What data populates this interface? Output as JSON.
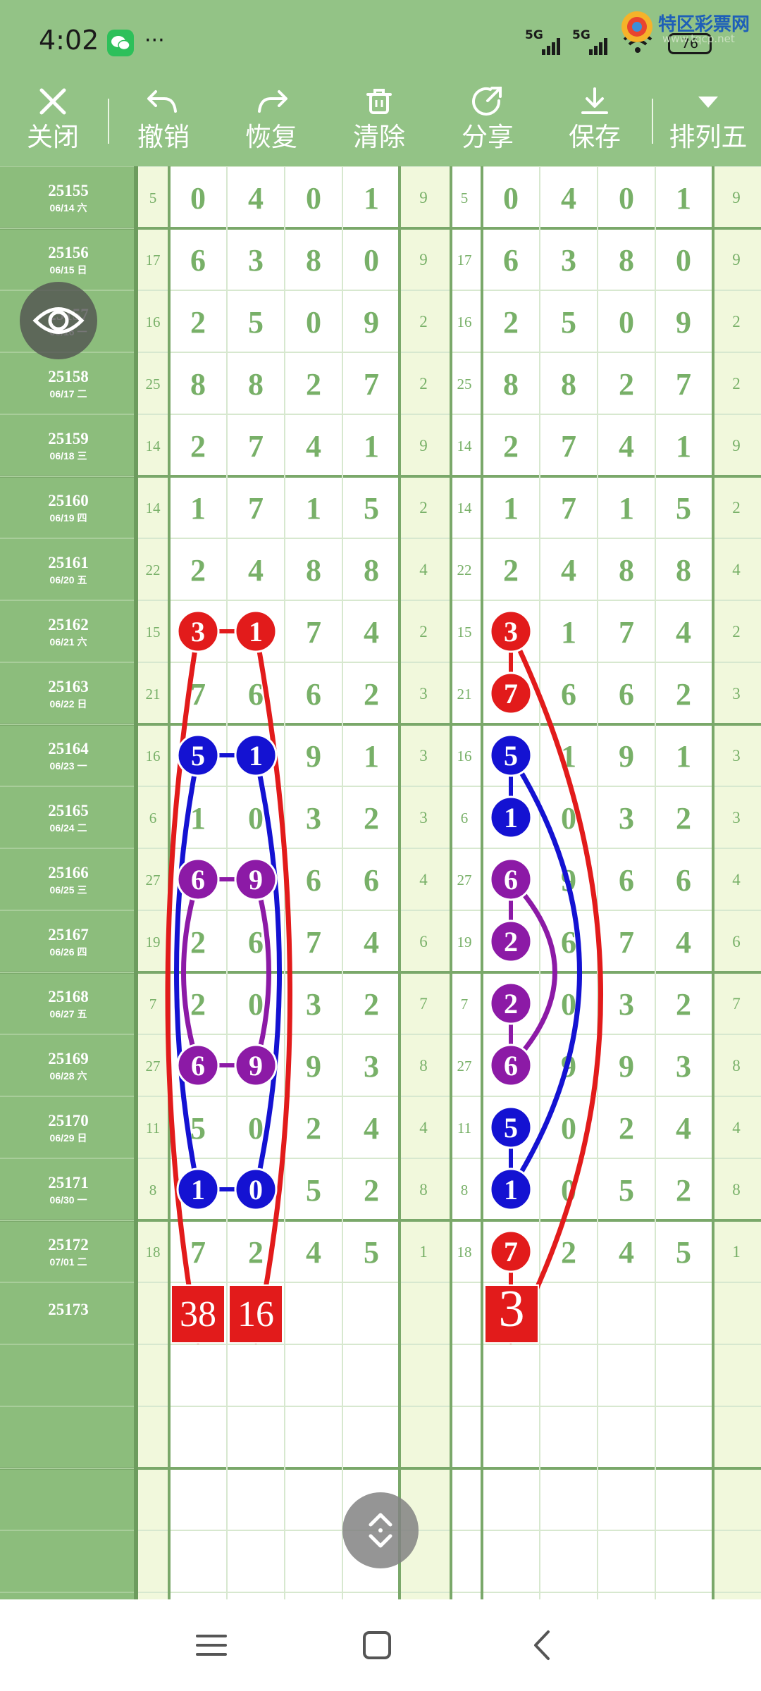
{
  "status_bar": {
    "time": "4:02",
    "network_1": "5G",
    "network_2": "5G",
    "battery": "76",
    "watermark_text": "特区彩票网",
    "watermark_url": "www.tqcp.net"
  },
  "toolbar": {
    "items": [
      {
        "label": "关闭",
        "icon": "close-icon"
      },
      {
        "label": "撤销",
        "icon": "undo-icon"
      },
      {
        "label": "恢复",
        "icon": "redo-icon"
      },
      {
        "label": "清除",
        "icon": "trash-icon"
      },
      {
        "label": "分享",
        "icon": "share-icon"
      },
      {
        "label": "保存",
        "icon": "download-icon"
      },
      {
        "label": "排列五",
        "icon": "dropdown-triangle-icon"
      }
    ]
  },
  "draws": [
    {
      "issue": "25155",
      "date": "06/14 六",
      "sum": "5",
      "d": [
        "0",
        "4",
        "0",
        "1",
        "9"
      ]
    },
    {
      "issue": "25156",
      "date": "06/15 日",
      "sum": "17",
      "d": [
        "6",
        "3",
        "8",
        "0",
        "9"
      ]
    },
    {
      "issue": "25157",
      "date": "06/16 一",
      "sum": "16",
      "d": [
        "2",
        "5",
        "0",
        "9",
        "2"
      ]
    },
    {
      "issue": "25158",
      "date": "06/17 二",
      "sum": "25",
      "d": [
        "8",
        "8",
        "2",
        "7",
        "2"
      ]
    },
    {
      "issue": "25159",
      "date": "06/18 三",
      "sum": "14",
      "d": [
        "2",
        "7",
        "4",
        "1",
        "9"
      ]
    },
    {
      "issue": "25160",
      "date": "06/19 四",
      "sum": "14",
      "d": [
        "1",
        "7",
        "1",
        "5",
        "2"
      ]
    },
    {
      "issue": "25161",
      "date": "06/20 五",
      "sum": "22",
      "d": [
        "2",
        "4",
        "8",
        "8",
        "4"
      ]
    },
    {
      "issue": "25162",
      "date": "06/21 六",
      "sum": "15",
      "d": [
        "3",
        "1",
        "7",
        "4",
        "2"
      ]
    },
    {
      "issue": "25163",
      "date": "06/22 日",
      "sum": "21",
      "d": [
        "7",
        "6",
        "6",
        "2",
        "3"
      ]
    },
    {
      "issue": "25164",
      "date": "06/23 一",
      "sum": "16",
      "d": [
        "5",
        "1",
        "9",
        "1",
        "3"
      ]
    },
    {
      "issue": "25165",
      "date": "06/24 二",
      "sum": "6",
      "d": [
        "1",
        "0",
        "3",
        "2",
        "3"
      ]
    },
    {
      "issue": "25166",
      "date": "06/25 三",
      "sum": "27",
      "d": [
        "6",
        "9",
        "6",
        "6",
        "4"
      ]
    },
    {
      "issue": "25167",
      "date": "06/26 四",
      "sum": "19",
      "d": [
        "2",
        "6",
        "7",
        "4",
        "6"
      ]
    },
    {
      "issue": "25168",
      "date": "06/27 五",
      "sum": "7",
      "d": [
        "2",
        "0",
        "3",
        "2",
        "7"
      ]
    },
    {
      "issue": "25169",
      "date": "06/28 六",
      "sum": "27",
      "d": [
        "6",
        "9",
        "9",
        "3",
        "8"
      ]
    },
    {
      "issue": "25170",
      "date": "06/29 日",
      "sum": "11",
      "d": [
        "5",
        "0",
        "2",
        "4",
        "4"
      ]
    },
    {
      "issue": "25171",
      "date": "06/30 一",
      "sum": "8",
      "d": [
        "1",
        "0",
        "5",
        "2",
        "8"
      ]
    },
    {
      "issue": "25172",
      "date": "07/01 二",
      "sum": "18",
      "d": [
        "7",
        "2",
        "4",
        "5",
        "1"
      ]
    },
    {
      "issue": "25173",
      "date": "",
      "sum": "",
      "d": [
        "",
        "",
        "",
        "",
        ""
      ]
    }
  ],
  "annotations": {
    "left_predictions": [
      "38",
      "16"
    ],
    "right_prediction": "3"
  },
  "colors": {
    "background_green": "#93c386",
    "sidebar_green": "#8cbd7c",
    "digit_green": "#78b068",
    "accent_red": "#e21b1b",
    "accent_blue": "#1412d2",
    "accent_purple": "#8c1aa6",
    "column_tint": "#f1f8dc"
  }
}
